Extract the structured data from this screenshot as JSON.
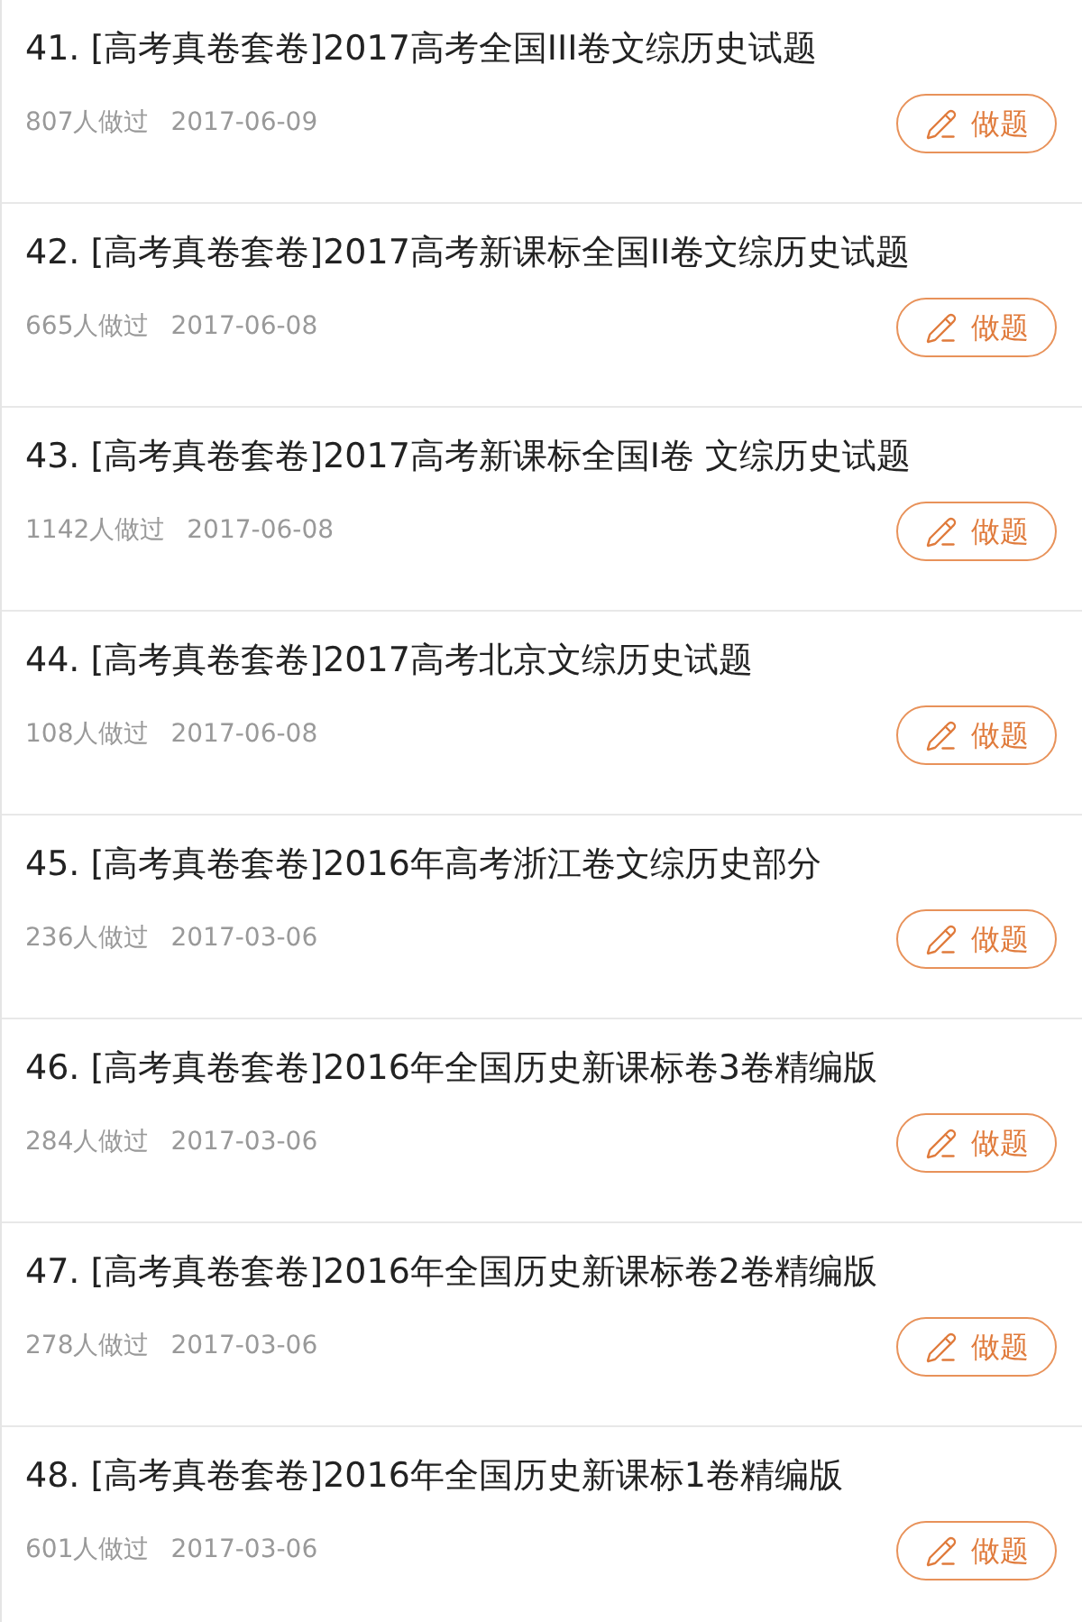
{
  "items": [
    {
      "title": "41. [高考真卷套卷]2017高考全国III卷文综历史试题",
      "count": "807人做过",
      "date": "2017-06-09",
      "button": "做题"
    },
    {
      "title": "42. [高考真卷套卷]2017高考新课标全国II卷文综历史试题",
      "count": "665人做过",
      "date": "2017-06-08",
      "button": "做题"
    },
    {
      "title": "43. [高考真卷套卷]2017高考新课标全国I卷 文综历史试题",
      "count": "1142人做过",
      "date": "2017-06-08",
      "button": "做题"
    },
    {
      "title": "44. [高考真卷套卷]2017高考北京文综历史试题",
      "count": "108人做过",
      "date": "2017-06-08",
      "button": "做题"
    },
    {
      "title": "45. [高考真卷套卷]2016年高考浙江卷文综历史部分",
      "count": "236人做过",
      "date": "2017-03-06",
      "button": "做题"
    },
    {
      "title": "46. [高考真卷套卷]2016年全国历史新课标卷3卷精编版",
      "count": "284人做过",
      "date": "2017-03-06",
      "button": "做题"
    },
    {
      "title": "47. [高考真卷套卷]2016年全国历史新课标卷2卷精编版",
      "count": "278人做过",
      "date": "2017-03-06",
      "button": "做题"
    },
    {
      "title": "48. [高考真卷套卷]2016年全国历史新课标1卷精编版",
      "count": "601人做过",
      "date": "2017-03-06",
      "button": "做题"
    }
  ]
}
